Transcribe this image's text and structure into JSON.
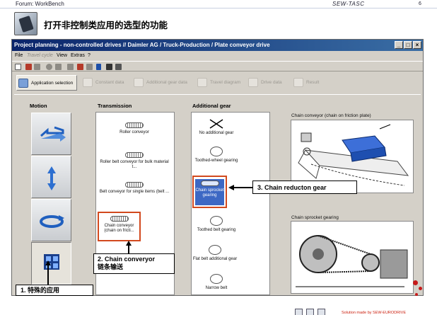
{
  "slide": {
    "forum_label": "Forum: WorkBench",
    "brand": "SEW-TASC",
    "page_number": "6",
    "title": "打开非控制类应用的选型的功能"
  },
  "window": {
    "title": "Project planning - non-controlled drives //      Daimler AG / Truck-Production / Plate conveyor drive",
    "controls": {
      "minimize": "_",
      "maximize": "□",
      "close": "×"
    },
    "menu": {
      "file": "File",
      "travel_cycle": "Travel cycle",
      "view": "View",
      "extras": "Extras",
      "help": "?"
    }
  },
  "steps": [
    {
      "label": "Application selection",
      "active": true
    },
    {
      "label": "Constant data",
      "active": false
    },
    {
      "label": "Additional gear data",
      "active": false
    },
    {
      "label": "Travel diagram",
      "active": false
    },
    {
      "label": "Drive data",
      "active": false
    },
    {
      "label": "Result",
      "active": false
    }
  ],
  "columns": {
    "motion": "Motion",
    "transmission": "Transmission",
    "additional_gear": "Additional gear"
  },
  "transmission_items": [
    "Roller conveyor",
    "Roller belt conveyor for bulk material t...",
    "Belt conveyor for single items (belt ...",
    "Chain conveyor (chain on fricti..."
  ],
  "gear_items": [
    "No additional gear",
    "Toothed-wheel gearing",
    "Chain sprocket gearing",
    "Toothed belt gearing",
    "Flat belt additional gear",
    "Narrow belt"
  ],
  "diagrams": {
    "conveyor_caption": "Chain conveyor (chain on friction plate)",
    "sprocket_caption": "Chain sprocket gearing"
  },
  "callouts": {
    "special_app": "1. 特殊的应用",
    "chain_conveyor_line1": "2. Chain converyor",
    "chain_conveyor_line2": "链条输送",
    "chain_reduction": "3. Chain reducton gear"
  },
  "footer": {
    "text": "Solution made by SEW-EURODRIVE"
  },
  "colors": {
    "titlebar": "#0a246a",
    "highlight": "#d2491e",
    "selection": "#3d68c4"
  }
}
